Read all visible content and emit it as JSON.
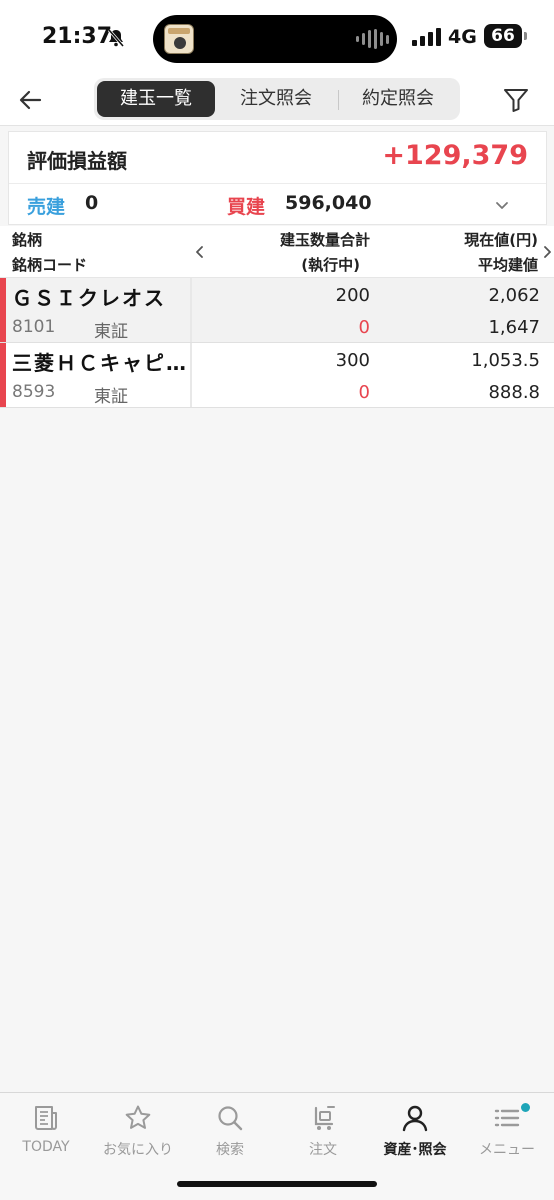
{
  "status_bar": {
    "time": "21:37",
    "network": "4G",
    "battery": "66"
  },
  "nav": {
    "tabs": [
      {
        "label": "建玉一覧",
        "active": true
      },
      {
        "label": "注文照会",
        "active": false
      },
      {
        "label": "約定照会",
        "active": false
      }
    ]
  },
  "summary": {
    "pl_label": "評価損益額",
    "pl_value": "+129,379",
    "sell_label": "売建",
    "sell_value": "0",
    "buy_label": "買建",
    "buy_value": "596,040"
  },
  "table": {
    "headers": {
      "col1_line1": "銘柄",
      "col1_line2": "銘柄コード",
      "col2_line1": "建玉数量合計",
      "col2_line2": "(執行中)",
      "col3_line1": "現在値(円)",
      "col3_line2": "平均建値"
    },
    "rows": [
      {
        "name": "ＧＳＩクレオス",
        "code": "8101",
        "market": "東証",
        "qty": "200",
        "exec": "0",
        "price": "2,062",
        "avg": "1,647"
      },
      {
        "name": "三菱ＨＣキャピ…",
        "code": "8593",
        "market": "東証",
        "qty": "300",
        "exec": "0",
        "price": "1,053.5",
        "avg": "888.8"
      }
    ]
  },
  "tabbar": {
    "items": [
      {
        "label": "TODAY",
        "icon": "news-icon"
      },
      {
        "label": "お気に入り",
        "icon": "star-icon"
      },
      {
        "label": "検索",
        "icon": "search-icon"
      },
      {
        "label": "注文",
        "icon": "cart-icon"
      },
      {
        "label": "資産･照会",
        "icon": "person-icon",
        "active": true
      },
      {
        "label": "メニュー",
        "icon": "menu-icon"
      }
    ]
  },
  "colors": {
    "positive": "#e8454f",
    "sell": "#3aa0dd",
    "active_tab_bg": "#2f2f2f",
    "notification_dot": "#1ea5b8"
  }
}
